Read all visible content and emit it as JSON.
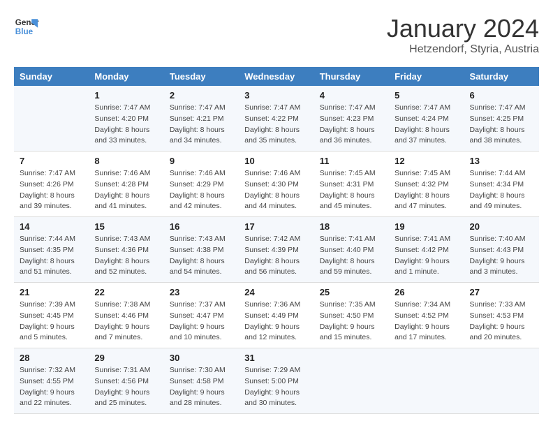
{
  "header": {
    "logo_line1": "General",
    "logo_line2": "Blue",
    "month_year": "January 2024",
    "location": "Hetzendorf, Styria, Austria"
  },
  "days_of_week": [
    "Sunday",
    "Monday",
    "Tuesday",
    "Wednesday",
    "Thursday",
    "Friday",
    "Saturday"
  ],
  "weeks": [
    [
      {
        "num": "",
        "sunrise": "",
        "sunset": "",
        "daylight": ""
      },
      {
        "num": "1",
        "sunrise": "Sunrise: 7:47 AM",
        "sunset": "Sunset: 4:20 PM",
        "daylight": "Daylight: 8 hours and 33 minutes."
      },
      {
        "num": "2",
        "sunrise": "Sunrise: 7:47 AM",
        "sunset": "Sunset: 4:21 PM",
        "daylight": "Daylight: 8 hours and 34 minutes."
      },
      {
        "num": "3",
        "sunrise": "Sunrise: 7:47 AM",
        "sunset": "Sunset: 4:22 PM",
        "daylight": "Daylight: 8 hours and 35 minutes."
      },
      {
        "num": "4",
        "sunrise": "Sunrise: 7:47 AM",
        "sunset": "Sunset: 4:23 PM",
        "daylight": "Daylight: 8 hours and 36 minutes."
      },
      {
        "num": "5",
        "sunrise": "Sunrise: 7:47 AM",
        "sunset": "Sunset: 4:24 PM",
        "daylight": "Daylight: 8 hours and 37 minutes."
      },
      {
        "num": "6",
        "sunrise": "Sunrise: 7:47 AM",
        "sunset": "Sunset: 4:25 PM",
        "daylight": "Daylight: 8 hours and 38 minutes."
      }
    ],
    [
      {
        "num": "7",
        "sunrise": "Sunrise: 7:47 AM",
        "sunset": "Sunset: 4:26 PM",
        "daylight": "Daylight: 8 hours and 39 minutes."
      },
      {
        "num": "8",
        "sunrise": "Sunrise: 7:46 AM",
        "sunset": "Sunset: 4:28 PM",
        "daylight": "Daylight: 8 hours and 41 minutes."
      },
      {
        "num": "9",
        "sunrise": "Sunrise: 7:46 AM",
        "sunset": "Sunset: 4:29 PM",
        "daylight": "Daylight: 8 hours and 42 minutes."
      },
      {
        "num": "10",
        "sunrise": "Sunrise: 7:46 AM",
        "sunset": "Sunset: 4:30 PM",
        "daylight": "Daylight: 8 hours and 44 minutes."
      },
      {
        "num": "11",
        "sunrise": "Sunrise: 7:45 AM",
        "sunset": "Sunset: 4:31 PM",
        "daylight": "Daylight: 8 hours and 45 minutes."
      },
      {
        "num": "12",
        "sunrise": "Sunrise: 7:45 AM",
        "sunset": "Sunset: 4:32 PM",
        "daylight": "Daylight: 8 hours and 47 minutes."
      },
      {
        "num": "13",
        "sunrise": "Sunrise: 7:44 AM",
        "sunset": "Sunset: 4:34 PM",
        "daylight": "Daylight: 8 hours and 49 minutes."
      }
    ],
    [
      {
        "num": "14",
        "sunrise": "Sunrise: 7:44 AM",
        "sunset": "Sunset: 4:35 PM",
        "daylight": "Daylight: 8 hours and 51 minutes."
      },
      {
        "num": "15",
        "sunrise": "Sunrise: 7:43 AM",
        "sunset": "Sunset: 4:36 PM",
        "daylight": "Daylight: 8 hours and 52 minutes."
      },
      {
        "num": "16",
        "sunrise": "Sunrise: 7:43 AM",
        "sunset": "Sunset: 4:38 PM",
        "daylight": "Daylight: 8 hours and 54 minutes."
      },
      {
        "num": "17",
        "sunrise": "Sunrise: 7:42 AM",
        "sunset": "Sunset: 4:39 PM",
        "daylight": "Daylight: 8 hours and 56 minutes."
      },
      {
        "num": "18",
        "sunrise": "Sunrise: 7:41 AM",
        "sunset": "Sunset: 4:40 PM",
        "daylight": "Daylight: 8 hours and 59 minutes."
      },
      {
        "num": "19",
        "sunrise": "Sunrise: 7:41 AM",
        "sunset": "Sunset: 4:42 PM",
        "daylight": "Daylight: 9 hours and 1 minute."
      },
      {
        "num": "20",
        "sunrise": "Sunrise: 7:40 AM",
        "sunset": "Sunset: 4:43 PM",
        "daylight": "Daylight: 9 hours and 3 minutes."
      }
    ],
    [
      {
        "num": "21",
        "sunrise": "Sunrise: 7:39 AM",
        "sunset": "Sunset: 4:45 PM",
        "daylight": "Daylight: 9 hours and 5 minutes."
      },
      {
        "num": "22",
        "sunrise": "Sunrise: 7:38 AM",
        "sunset": "Sunset: 4:46 PM",
        "daylight": "Daylight: 9 hours and 7 minutes."
      },
      {
        "num": "23",
        "sunrise": "Sunrise: 7:37 AM",
        "sunset": "Sunset: 4:47 PM",
        "daylight": "Daylight: 9 hours and 10 minutes."
      },
      {
        "num": "24",
        "sunrise": "Sunrise: 7:36 AM",
        "sunset": "Sunset: 4:49 PM",
        "daylight": "Daylight: 9 hours and 12 minutes."
      },
      {
        "num": "25",
        "sunrise": "Sunrise: 7:35 AM",
        "sunset": "Sunset: 4:50 PM",
        "daylight": "Daylight: 9 hours and 15 minutes."
      },
      {
        "num": "26",
        "sunrise": "Sunrise: 7:34 AM",
        "sunset": "Sunset: 4:52 PM",
        "daylight": "Daylight: 9 hours and 17 minutes."
      },
      {
        "num": "27",
        "sunrise": "Sunrise: 7:33 AM",
        "sunset": "Sunset: 4:53 PM",
        "daylight": "Daylight: 9 hours and 20 minutes."
      }
    ],
    [
      {
        "num": "28",
        "sunrise": "Sunrise: 7:32 AM",
        "sunset": "Sunset: 4:55 PM",
        "daylight": "Daylight: 9 hours and 22 minutes."
      },
      {
        "num": "29",
        "sunrise": "Sunrise: 7:31 AM",
        "sunset": "Sunset: 4:56 PM",
        "daylight": "Daylight: 9 hours and 25 minutes."
      },
      {
        "num": "30",
        "sunrise": "Sunrise: 7:30 AM",
        "sunset": "Sunset: 4:58 PM",
        "daylight": "Daylight: 9 hours and 28 minutes."
      },
      {
        "num": "31",
        "sunrise": "Sunrise: 7:29 AM",
        "sunset": "Sunset: 5:00 PM",
        "daylight": "Daylight: 9 hours and 30 minutes."
      },
      {
        "num": "",
        "sunrise": "",
        "sunset": "",
        "daylight": ""
      },
      {
        "num": "",
        "sunrise": "",
        "sunset": "",
        "daylight": ""
      },
      {
        "num": "",
        "sunrise": "",
        "sunset": "",
        "daylight": ""
      }
    ]
  ]
}
